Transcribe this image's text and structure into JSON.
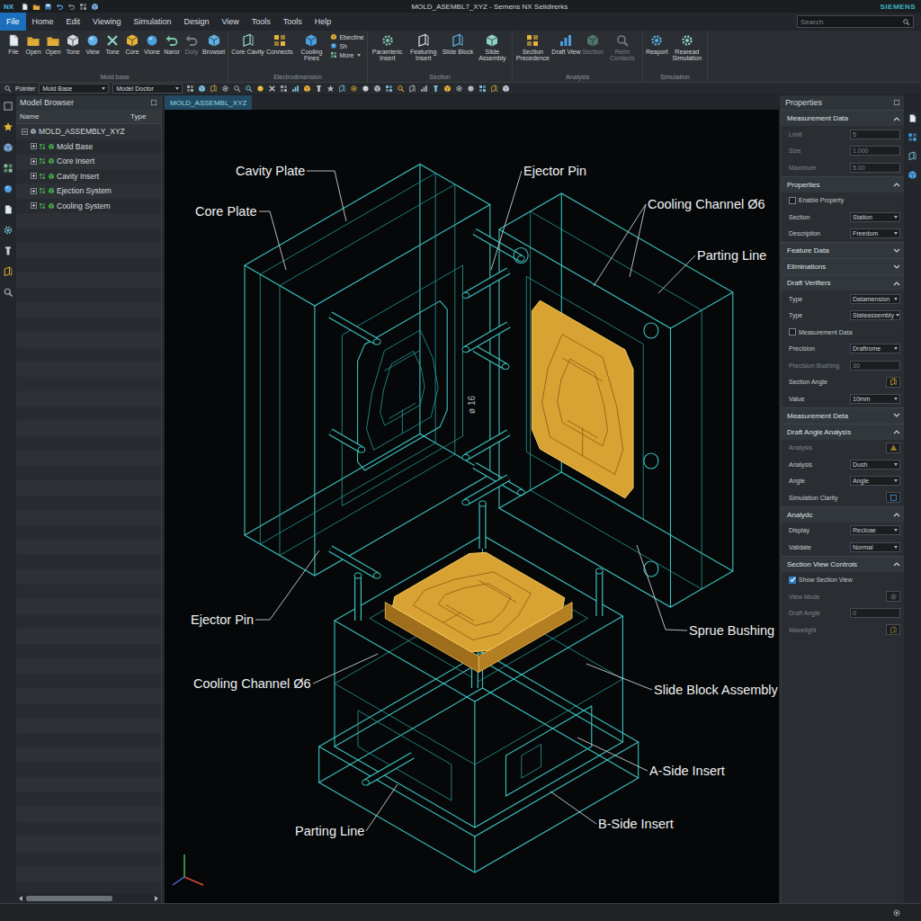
{
  "window": {
    "logo": "NX",
    "title": "MOLD_ASEMBL7_XYZ - Semens NX Selidirerks",
    "brand": "SIEMENS"
  },
  "menu": [
    {
      "label": "File",
      "selected": true
    },
    {
      "label": "Home",
      "selected": false
    },
    {
      "label": "Edit",
      "selected": false
    },
    {
      "label": "Viewing",
      "selected": false
    },
    {
      "label": "Simulation",
      "selected": false
    },
    {
      "label": "Design",
      "selected": false
    },
    {
      "label": "View",
      "selected": false
    },
    {
      "label": "Tools",
      "selected": false
    },
    {
      "label": "Tools",
      "selected": false
    },
    {
      "label": "Help",
      "selected": false
    }
  ],
  "search": {
    "placeholder": "Search"
  },
  "ribbon": [
    {
      "label": "Mold base",
      "buttons": [
        {
          "kind": "large",
          "label": "File",
          "disabled": false
        },
        {
          "kind": "large",
          "label": "Open",
          "disabled": false
        },
        {
          "kind": "large",
          "label": "Open",
          "disabled": false
        },
        {
          "kind": "large",
          "label": "Tone",
          "disabled": false
        },
        {
          "kind": "large",
          "label": "View",
          "disabled": false
        },
        {
          "kind": "large",
          "label": "Tone",
          "disabled": false
        },
        {
          "kind": "large",
          "label": "Core",
          "disabled": false
        },
        {
          "kind": "large",
          "label": "Vione",
          "disabled": false
        },
        {
          "kind": "large",
          "label": "Naror",
          "disabled": false
        },
        {
          "kind": "large",
          "label": "Doty",
          "disabled": true
        },
        {
          "kind": "large",
          "label": "Browset",
          "disabled": false
        }
      ]
    },
    {
      "label": "Electrodimension",
      "buttons": [
        {
          "kind": "large",
          "label": "Core Cavity",
          "disabled": false
        },
        {
          "kind": "large",
          "label": "Connects",
          "disabled": false
        },
        {
          "kind": "large",
          "label": "Cooling Fines",
          "disabled": false
        },
        {
          "kind": "stack",
          "items": [
            "Ebectine",
            "Sh",
            "More"
          ],
          "disabled": false
        }
      ]
    },
    {
      "label": "Section",
      "buttons": [
        {
          "kind": "large",
          "label": "Paramteric Insert",
          "disabled": false
        },
        {
          "kind": "large",
          "label": "Featuring Insert",
          "disabled": false
        },
        {
          "kind": "large",
          "label": "Slide Block",
          "disabled": false
        },
        {
          "kind": "large",
          "label": "Slide Assembly",
          "disabled": false
        }
      ]
    },
    {
      "label": "Analysis",
      "buttons": [
        {
          "kind": "large",
          "label": "Section Precedence",
          "disabled": false
        },
        {
          "kind": "large",
          "label": "Draft View",
          "disabled": false
        },
        {
          "kind": "large",
          "label": "Section",
          "disabled": true
        },
        {
          "kind": "large",
          "label": "Reim Contacts",
          "disabled": true
        }
      ]
    },
    {
      "label": "Simulation",
      "buttons": [
        {
          "kind": "large",
          "label": "Reaport",
          "disabled": false
        },
        {
          "kind": "large",
          "label": "Rearead Simulation",
          "disabled": false
        }
      ]
    }
  ],
  "toolbar": {
    "filter": "Pointer",
    "dropdowns": [
      "Mold Base",
      "Model Doctor"
    ]
  },
  "model_browser": {
    "title": "Model Browser",
    "columns": [
      "Name",
      "Type"
    ],
    "tree": [
      {
        "name": "MOLD_ASSEMBLY_XYZ",
        "kind": "root",
        "expanded": true
      },
      {
        "name": "Mold Base",
        "kind": "child",
        "expanded": false
      },
      {
        "name": "Core Insert",
        "kind": "child",
        "expanded": false
      },
      {
        "name": "Cavity Insert",
        "kind": "child",
        "expanded": false
      },
      {
        "name": "Ejection System",
        "kind": "child",
        "expanded": false
      },
      {
        "name": "Cooling System",
        "kind": "child",
        "expanded": false
      }
    ]
  },
  "viewport": {
    "tab": "MOLD_ASSEMBL_XYZ",
    "labels": [
      "Cavity Plate",
      "Core Plate",
      "Ejector Pin",
      "Cooling Channel Ø6",
      "Parting Line",
      "Ejector Pin",
      "Cooling Channel Ø6",
      "Sprue Bushing",
      "Slide Block Assembly",
      "A-Side Insert",
      "B-Side Insert",
      "Parting Line"
    ],
    "dimension": "ø 16"
  },
  "properties": {
    "title": "Properties",
    "sections": [
      {
        "title": "Measurement Data",
        "expanded": true,
        "rows": [
          {
            "kind": "field",
            "label": "Limit",
            "value": "5",
            "disabled": true
          },
          {
            "kind": "field",
            "label": "Size",
            "value": "1.000",
            "disabled": true
          },
          {
            "kind": "field",
            "label": "Maximum",
            "value": "5.00",
            "disabled": true
          }
        ]
      },
      {
        "title": "Properties",
        "expanded": true,
        "rows": [
          {
            "kind": "checkbox",
            "label": "Enable Property",
            "checked": false,
            "disabled": false
          },
          {
            "kind": "dropdown",
            "label": "Section",
            "value": "Station",
            "disabled": false
          },
          {
            "kind": "dropdown",
            "label": "Description",
            "value": "Freedom",
            "disabled": false
          }
        ]
      },
      {
        "title": "Feature Data",
        "expanded": false,
        "rows": []
      },
      {
        "title": "Eliminations",
        "expanded": false,
        "rows": []
      },
      {
        "title": "Draft Verifiers",
        "expanded": true,
        "rows": [
          {
            "kind": "dropdown",
            "label": "Type",
            "value": "Datamension",
            "disabled": false
          },
          {
            "kind": "dropdown",
            "label": "Type",
            "value": "Stateassembly",
            "disabled": false
          },
          {
            "kind": "checkbox",
            "label": "Measurement Data",
            "checked": false,
            "disabled": false
          },
          {
            "kind": "dropdown",
            "label": "Precision",
            "value": "Draftrome",
            "disabled": false
          },
          {
            "kind": "field",
            "label": "Precision Bushing",
            "value": "30",
            "disabled": true
          },
          {
            "kind": "icon",
            "label": "Section Angle",
            "disabled": false
          },
          {
            "kind": "dropdown",
            "label": "Value",
            "value": "10mm",
            "disabled": false
          }
        ]
      },
      {
        "title": "Measurement Deta",
        "expanded": false,
        "rows": []
      },
      {
        "title": "Draft Angle Analysis",
        "expanded": true,
        "rows": [
          {
            "kind": "icon",
            "label": "Analysis",
            "disabled": true
          },
          {
            "kind": "dropdown",
            "label": "Analysis",
            "value": "Dush",
            "disabled": false
          },
          {
            "kind": "dropdown",
            "label": "Angle",
            "value": "Angle",
            "disabled": false
          },
          {
            "kind": "icon",
            "label": "Simulation Clarity",
            "disabled": false
          }
        ]
      },
      {
        "title": "Analydc",
        "expanded": true,
        "rows": [
          {
            "kind": "dropdown",
            "label": "Display",
            "value": "Recloae",
            "disabled": false
          },
          {
            "kind": "dropdown",
            "label": "Validate",
            "value": "Normal",
            "disabled": false
          }
        ]
      },
      {
        "title": "Section View Controls",
        "expanded": true,
        "rows": [
          {
            "kind": "checkbox",
            "label": "Show Section View",
            "checked": true,
            "disabled": false
          },
          {
            "kind": "icon",
            "label": "View Mode",
            "disabled": true
          },
          {
            "kind": "field",
            "label": "Draft Angle",
            "value": "0",
            "disabled": true
          },
          {
            "kind": "icon",
            "label": "Wavelight",
            "disabled": true
          }
        ]
      }
    ]
  }
}
